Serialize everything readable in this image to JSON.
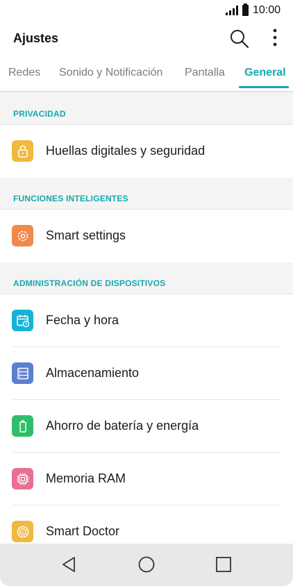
{
  "status_bar": {
    "time": "10:00"
  },
  "app_bar": {
    "title": "Ajustes",
    "search_icon": "search-icon",
    "more_icon": "more-vertical-icon"
  },
  "tabs": [
    {
      "label": "Redes",
      "active": false
    },
    {
      "label": "Sonido y Notificación",
      "active": false
    },
    {
      "label": "Pantalla",
      "active": false
    },
    {
      "label": "General",
      "active": true
    }
  ],
  "colors": {
    "accent": "#16a8ae",
    "privacy_icon": "#f0b93f",
    "smart_settings_icon": "#f0894a",
    "date_icon": "#15b3d6",
    "storage_icon": "#5b7fd1",
    "battery_icon": "#2fbf6a",
    "ram_icon": "#ea6f93",
    "doctor_icon": "#f0b93f"
  },
  "sections": [
    {
      "header": "PRIVACIDAD",
      "items": [
        {
          "label": "Huellas digitales y seguridad",
          "icon": "lock-icon"
        }
      ]
    },
    {
      "header": "FUNCIONES INTELIGENTES",
      "items": [
        {
          "label": "Smart settings",
          "icon": "smart-settings-gear-icon"
        }
      ]
    },
    {
      "header": "ADMINISTRACIÓN DE DISPOSITIVOS",
      "items": [
        {
          "label": "Fecha y hora",
          "icon": "calendar-clock-icon"
        },
        {
          "label": "Almacenamiento",
          "icon": "storage-icon"
        },
        {
          "label": "Ahorro de batería y energía",
          "icon": "battery-icon"
        },
        {
          "label": "Memoria RAM",
          "icon": "memory-chip-icon"
        },
        {
          "label": "Smart Doctor",
          "icon": "smart-doctor-icon"
        }
      ]
    }
  ],
  "nav_bar": {
    "back_icon": "back-triangle-icon",
    "home_icon": "home-circle-icon",
    "recents_icon": "recents-square-icon"
  }
}
